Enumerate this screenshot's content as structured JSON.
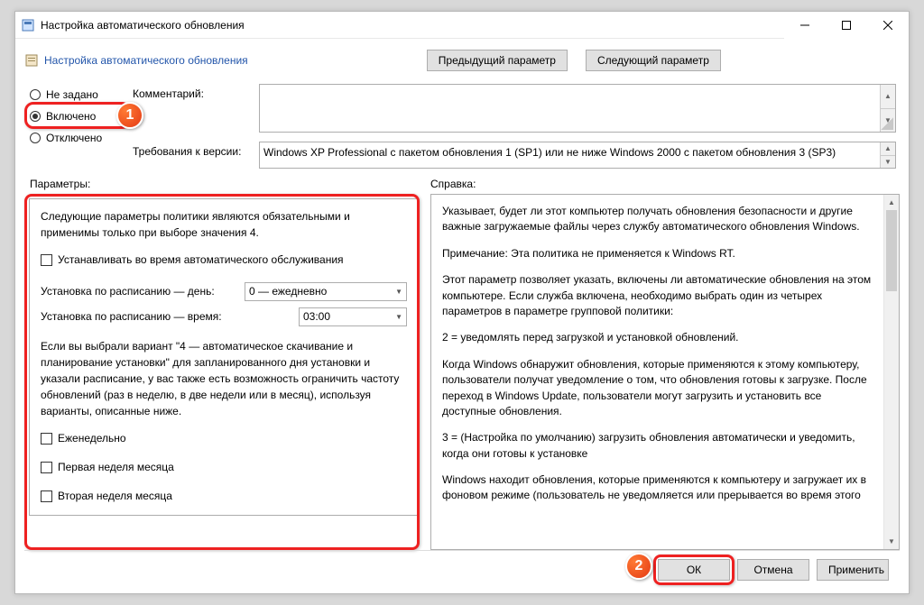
{
  "titlebar": {
    "title": "Настройка автоматического обновления"
  },
  "header": {
    "title": "Настройка автоматического обновления",
    "prev": "Предыдущий параметр",
    "next": "Следующий параметр"
  },
  "state": {
    "not_configured": "Не задано",
    "enabled": "Включено",
    "disabled": "Отключено",
    "selected": "enabled"
  },
  "comment": {
    "label": "Комментарий:",
    "value": ""
  },
  "requirements": {
    "label": "Требования к версии:",
    "value": "Windows XP Professional с пакетом обновления 1 (SP1) или не ниже Windows 2000 с пакетом обновления 3 (SP3)"
  },
  "mid": {
    "params_label": "Параметры:",
    "help_label": "Справка:"
  },
  "options": {
    "intro": "Следующие параметры политики являются обязательными и применимы только при выборе значения 4.",
    "chk_install_maint": "Устанавливать во время автоматического обслуживания",
    "day_label": "Установка по расписанию — день:",
    "day_value": "0 — ежедневно",
    "time_label": "Установка по расписанию — время:",
    "time_value": "03:00",
    "recurrence_text": "Если вы выбрали вариант \"4 — автоматическое скачивание и планирование установки\" для запланированного дня установки и указали расписание, у вас также есть возможность ограничить частоту обновлений (раз в неделю, в две недели или в месяц), используя варианты, описанные ниже.",
    "chk_weekly": "Еженедельно",
    "chk_w1": "Первая неделя месяца",
    "chk_w2": "Вторая неделя месяца"
  },
  "help": {
    "p1": "Указывает, будет ли этот компьютер получать обновления безопасности и другие важные загружаемые файлы через службу автоматического обновления Windows.",
    "p2": "Примечание: Эта политика не применяется к Windows RT.",
    "p3": "Этот параметр позволяет указать, включены ли автоматические обновления на этом компьютере. Если служба включена, необходимо выбрать один из четырех параметров в параметре групповой политики:",
    "p4": "2 = уведомлять перед загрузкой и установкой обновлений.",
    "p5": "Когда Windows обнаружит обновления, которые применяются к этому компьютеру, пользователи получат уведомление о том, что обновления готовы к загрузке. После переход в Windows Update, пользователи могут загрузить и установить все доступные обновления.",
    "p6": "3 = (Настройка по умолчанию) загрузить обновления автоматически и уведомить, когда они готовы к установке",
    "p7": "Windows находит обновления, которые применяются к компьютеру и загружает их в фоновом режиме (пользователь не уведомляется или прерывается во время этого"
  },
  "footer": {
    "ok": "ОК",
    "cancel": "Отмена",
    "apply": "Применить"
  },
  "annotations": {
    "step1": "1",
    "step2": "2"
  }
}
